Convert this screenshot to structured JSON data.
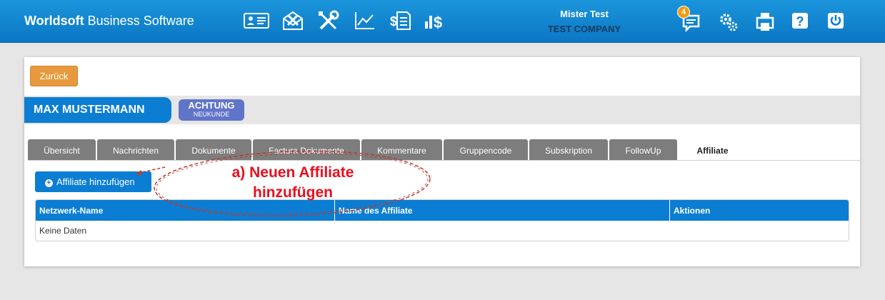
{
  "header": {
    "brand_bold": "Worldsoft",
    "brand_rest": " Business Software",
    "nav_icons": [
      "contact-card-icon",
      "mail-tools-icon",
      "wrench-screwdriver-icon",
      "chart-line-icon",
      "invoice-dollar-icon",
      "bar-dollar-icon"
    ],
    "user_name": "Mister Test",
    "company": "TEST COMPANY",
    "notification_count": "4",
    "right_icons": [
      "chat-icon",
      "gears-icon",
      "print-icon",
      "help-icon",
      "power-icon"
    ]
  },
  "toolbar": {
    "back_label": "Zurück"
  },
  "customer": {
    "name": "MAX MUSTERMANN",
    "warning_title": "ACHTUNG",
    "warning_sub": "NEUKUNDE"
  },
  "tabs": [
    {
      "label": "Übersicht"
    },
    {
      "label": "Nachrichten"
    },
    {
      "label": "Dokumente"
    },
    {
      "label": "Factura Dokumente"
    },
    {
      "label": "Kommentare"
    },
    {
      "label": "Gruppencode"
    },
    {
      "label": "Subskription"
    },
    {
      "label": "FollowUp"
    },
    {
      "label": "Affiliate"
    }
  ],
  "affiliate": {
    "add_label": "Affiliate hinzufügen",
    "columns": [
      "Netzwerk-Name",
      "Name des Affiliate",
      "Aktionen"
    ],
    "empty_text": "Keine Daten"
  },
  "annotation": {
    "line1": "a) Neuen Affiliate",
    "line2": "hinzufügen",
    "color": "#e8101e"
  },
  "colors": {
    "header_blue": "#0b7ed3",
    "back_orange": "#e79a3d",
    "warning_purple": "#6074c8",
    "tab_gray": "#7d7d7d",
    "badge_orange": "#f39c12"
  }
}
